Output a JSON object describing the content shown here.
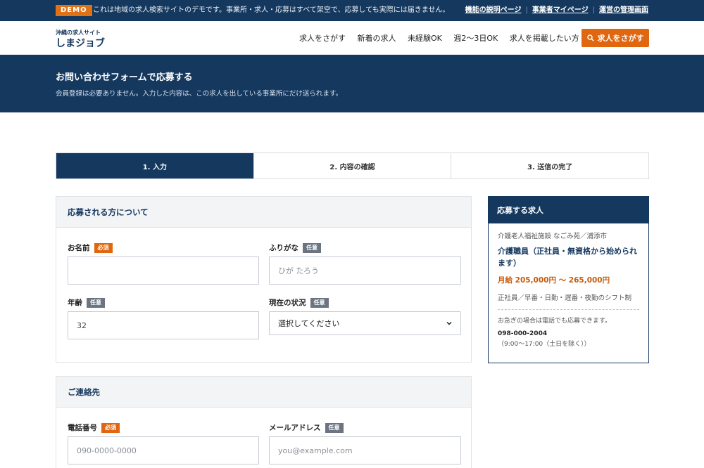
{
  "demo": {
    "badge": "DEMO",
    "notice": "これは地域の求人検索サイトのデモです。事業所・求人・応募はすべて架空で、応募しても実際には届きません。",
    "links": [
      "機能の説明ページ",
      "事業者マイページ",
      "運営の管理画面"
    ]
  },
  "header": {
    "logo_sub": "沖縄の求人サイト",
    "logo_main": "しまジョブ",
    "nav": [
      "求人をさがす",
      "新着の求人",
      "未経験OK",
      "週2〜3日OK",
      "求人を掲載したい方"
    ],
    "search_button": "求人をさがす"
  },
  "hero": {
    "title": "お問い合わせフォームで応募する",
    "description": "会員登録は必要ありません。入力した内容は、この求人を出している事業所にだけ送られます。"
  },
  "steps": [
    "1. 入力",
    "2. 内容の確認",
    "3. 送信の完了"
  ],
  "section1": {
    "title": "応募される方について",
    "name": {
      "label": "お名前",
      "badge": "必須",
      "value": ""
    },
    "kana": {
      "label": "ふりがな",
      "badge": "任意",
      "placeholder": "ひが たろう"
    },
    "age": {
      "label": "年齢",
      "badge": "任意",
      "value": "32"
    },
    "status": {
      "label": "現在の状況",
      "badge": "任意",
      "selected": "選択してください"
    }
  },
  "section2": {
    "title": "ご連絡先",
    "phone": {
      "label": "電話番号",
      "badge": "必須",
      "placeholder": "090-0000-0000"
    },
    "email": {
      "label": "メールアドレス",
      "badge": "任意",
      "placeholder": "you@example.com"
    }
  },
  "sidebar": {
    "title": "応募する求人",
    "company": "介護老人福祉施設 なごみ苑／浦添市",
    "job_title": "介護職員（正社員・無資格から始められます）",
    "salary": "月給 205,000円 〜 265,000円",
    "shift": "正社員／早番・日勤・遅番・夜勤のシフト制",
    "urgent": "お急ぎの場合は電話でも応募できます。",
    "phone": "098-000-2004",
    "hours": "（9:00〜17:00（土日を除く））"
  }
}
